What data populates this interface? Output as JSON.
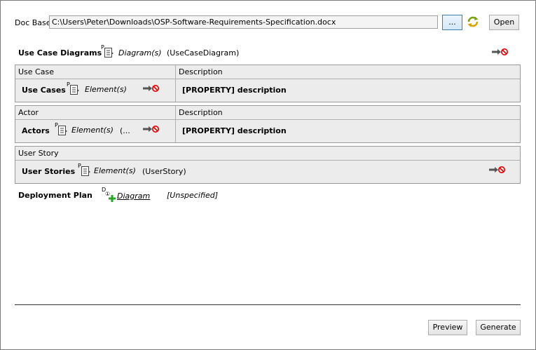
{
  "doc_base": {
    "label": "Doc Base:",
    "path": "C:\\Users\\Peter\\Downloads\\OSP-Software-Requirements-Specification.docx",
    "browse_label": "...",
    "open_label": "Open"
  },
  "use_case_diagrams": {
    "title": "Use Case Diagrams",
    "marker": "P",
    "type_label": "Diagram(s)",
    "filter": "(UseCaseDiagram)"
  },
  "use_case_table": {
    "col1": "Use Case",
    "col2": "Description",
    "row_title": "Use Cases",
    "marker": "P",
    "type_label": "Element(s)",
    "description": "[PROPERTY] description"
  },
  "actor_table": {
    "col1": "Actor",
    "col2": "Description",
    "row_title": "Actors",
    "marker": "P",
    "type_label": "Element(s)",
    "filter": "(...",
    "description": "[PROPERTY] description"
  },
  "user_story_table": {
    "col1": "User Story",
    "row_title": "User Stories",
    "marker": "P",
    "type_label": "Element(s)",
    "filter": "(UserStory)"
  },
  "deployment_plan": {
    "title": "Deployment Plan",
    "marker": "D",
    "marker_sub": "①",
    "type_label": "Diagram",
    "filter": "[Unspecified]"
  },
  "footer": {
    "preview_label": "Preview",
    "generate_label": "Generate"
  }
}
